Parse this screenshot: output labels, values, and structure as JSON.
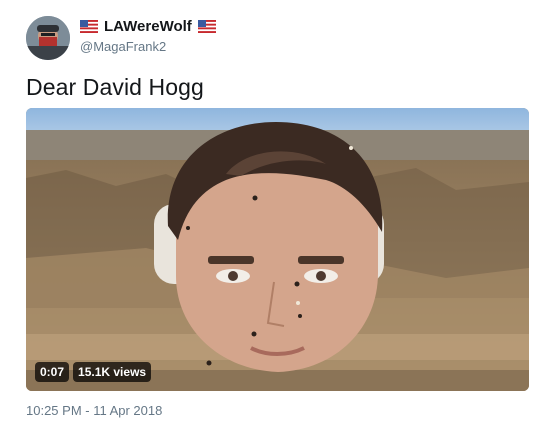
{
  "author": {
    "display_name": "LAWereWolf",
    "handle": "@MagaFrank2",
    "name_decoration_icon": "us-flag-icon"
  },
  "tweet": {
    "text": "Dear David Hogg",
    "timestamp": "10:25 PM - 11 Apr 2018"
  },
  "video": {
    "duration": "0:07",
    "views": "15.1K views"
  },
  "colors": {
    "text_primary": "#14171a",
    "text_secondary": "#657786",
    "badge_bg": "#000000"
  }
}
